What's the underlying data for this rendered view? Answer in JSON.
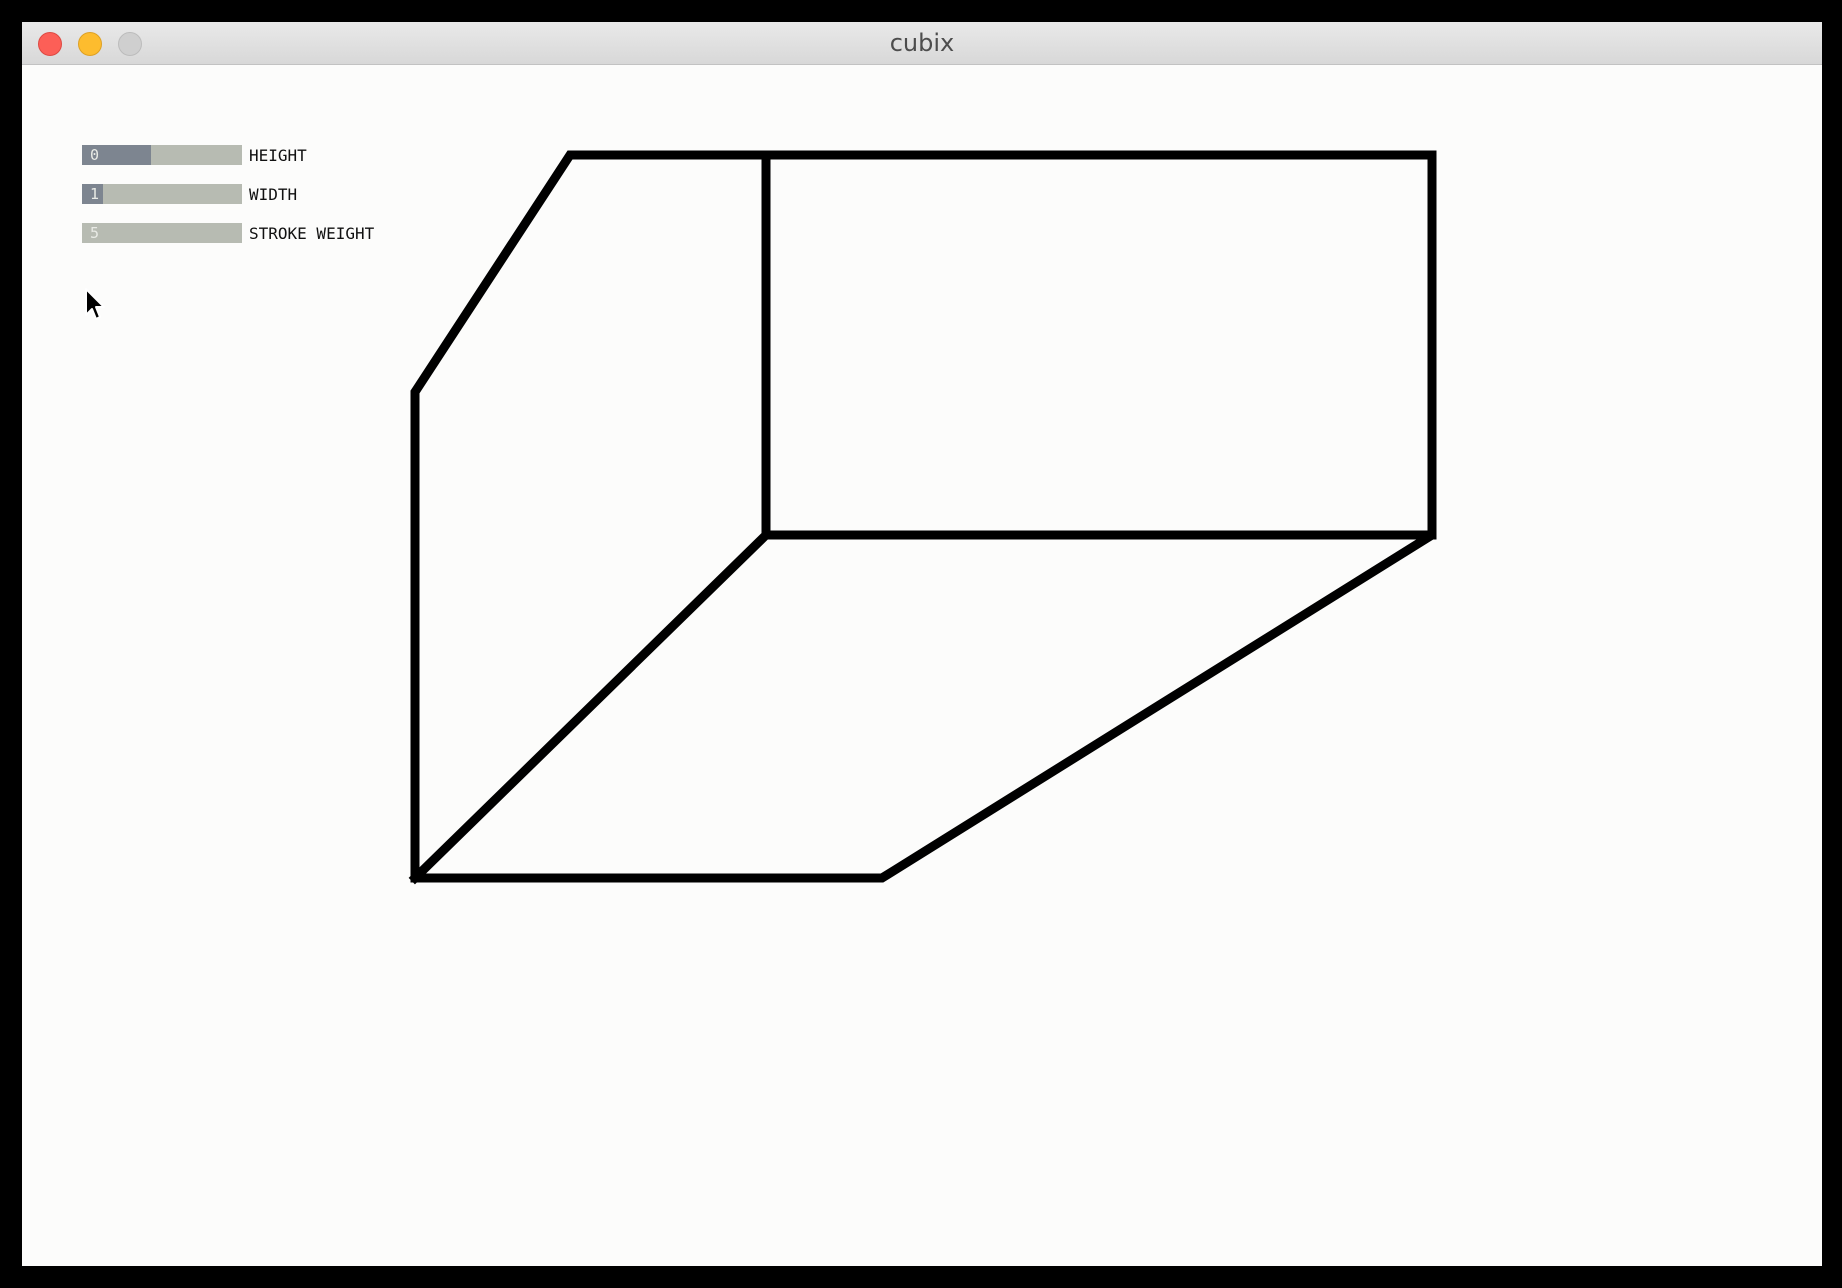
{
  "window": {
    "title": "cubix"
  },
  "controls": {
    "sliders": [
      {
        "id": "height",
        "label": "HEIGHT",
        "value": "0",
        "fill_fraction": 0.43
      },
      {
        "id": "width",
        "label": "WIDTH",
        "value": "1",
        "fill_fraction": 0.13
      },
      {
        "id": "stroke-weight",
        "label": "STROKE WEIGHT",
        "value": "5",
        "fill_fraction": 0.0
      }
    ]
  },
  "colors": {
    "slider_track": "#b7bbb2",
    "slider_fill": "#7d8590",
    "stroke": "#000000",
    "background": "#fcfcfb"
  },
  "icons": {
    "cursor": "arrow-cursor-icon"
  }
}
